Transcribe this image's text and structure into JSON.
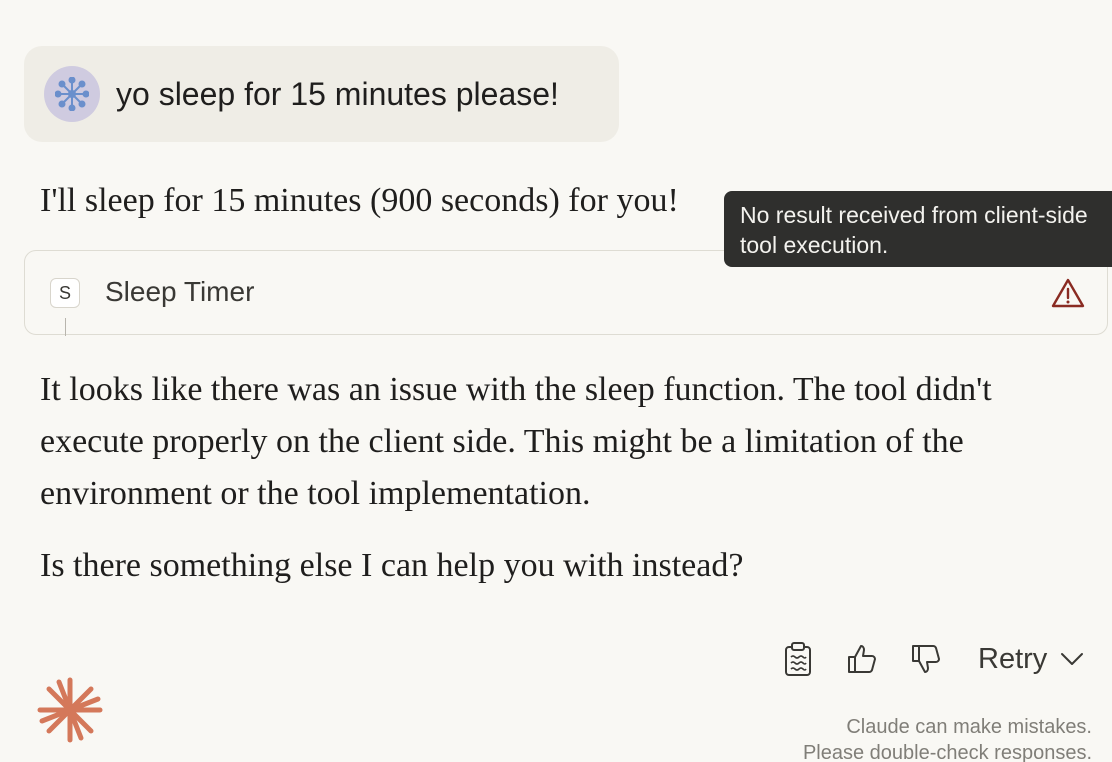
{
  "conversation": {
    "user_message": "yo sleep for 15 minutes please!",
    "assistant_intro": "I'll sleep for 15 minutes (900 seconds) for you!",
    "tool": {
      "badge": "S",
      "name": "Sleep Timer",
      "status_icon": "warning-triangle-icon",
      "tooltip": "No result received from client-side tool execution."
    },
    "assistant_reply_1": "It looks like there was an issue with the sleep function. The tool didn't execute properly on the client side. This might be a limitation of the environment or the tool implementation.",
    "assistant_reply_2": "Is there something else I can help you with instead?"
  },
  "actions": {
    "copy_icon": "clipboard-icon",
    "thumbs_up_icon": "thumbs-up-icon",
    "thumbs_down_icon": "thumbs-down-icon",
    "retry_label": "Retry",
    "retry_menu_icon": "chevron-down-icon"
  },
  "footer": {
    "disclaimer_line_1": "Claude can make mistakes.",
    "disclaimer_line_2": "Please double-check responses."
  },
  "colors": {
    "background": "#f9f8f4",
    "user_bubble": "#efede6",
    "avatar": "#cfcbe0",
    "avatar_icon": "#6a8fcc",
    "tooltip_bg": "#2f2f2d",
    "warning": "#8a2b22",
    "brand_logo": "#d4785a"
  }
}
